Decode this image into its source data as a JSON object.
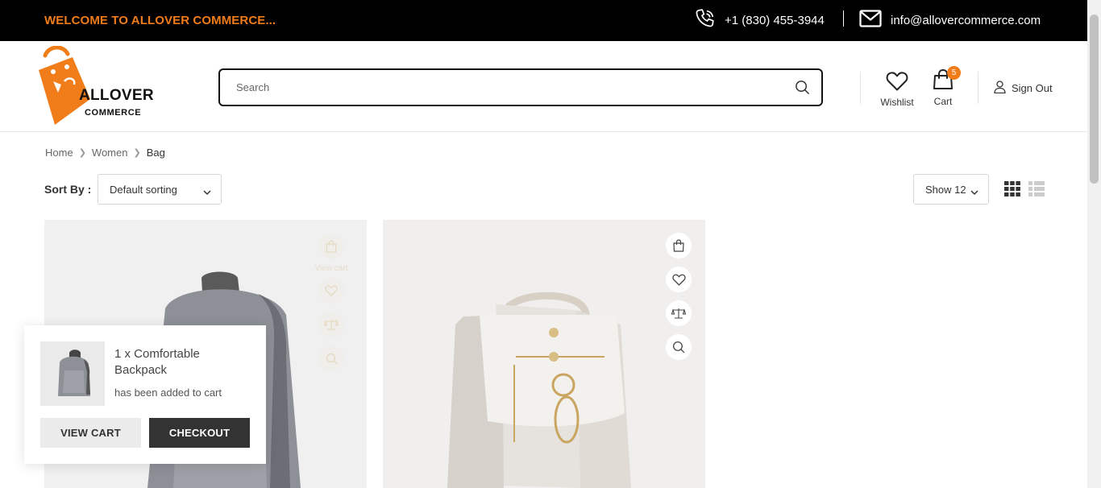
{
  "topbar": {
    "welcome": "WELCOME TO ALLOVER COMMERCE...",
    "phone": "+1 (830) 455-3944",
    "email": "info@allovercommerce.com"
  },
  "header": {
    "logo_line1": "ALLOVER",
    "logo_line2": "COMMERCE",
    "search_placeholder": "Search",
    "wishlist_label": "Wishlist",
    "cart_label": "Cart",
    "cart_count": "5",
    "signout_label": "Sign Out"
  },
  "breadcrumb": {
    "items": [
      "Home",
      "Women",
      "Bag"
    ]
  },
  "toolbar": {
    "sort_label": "Sort By :",
    "sort_value": "Default sorting",
    "show_value": "Show 12"
  },
  "products": [
    {
      "name": "Comfortable Backpack",
      "view_cart_label": "View cart"
    },
    {
      "name": "White Handbag"
    }
  ],
  "toast": {
    "product_line": "1 x Comfortable Backpack",
    "message": "has been added to cart",
    "view_cart": "VIEW CART",
    "checkout": "CHECKOUT"
  },
  "colors": {
    "accent": "#f07c1a",
    "dark": "#000000",
    "button_dark": "#333333"
  },
  "icons": [
    "phone-icon",
    "mail-icon",
    "search-icon",
    "heart-icon",
    "shopping-bag-icon",
    "user-icon",
    "grid-view-icon",
    "list-view-icon",
    "compare-icon",
    "zoom-icon",
    "chevron-down-icon"
  ]
}
